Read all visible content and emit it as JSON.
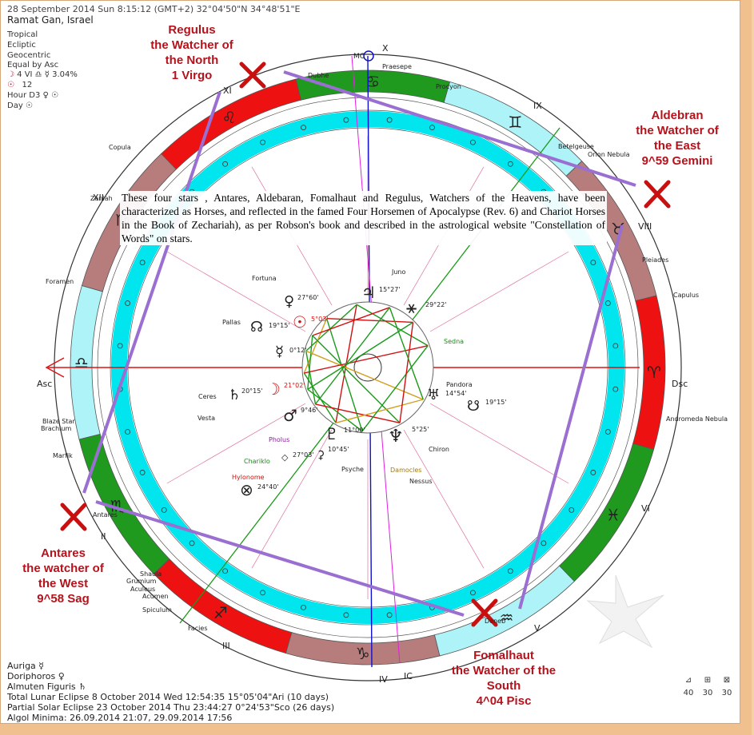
{
  "header": {
    "datetime": "28 September 2014   Sun    8:15:12 (GMT+2) 32°04'50\"N  34°48'51\"E",
    "place": "Ramat Gan, Israel",
    "settings": [
      "Tropical",
      "Ecliptic",
      "Geocentric",
      "Equal by Asc"
    ],
    "moon_phase": "4 VI ♎ ☿ 3.04%",
    "sun_line": "12",
    "hour": "Hour D3 ♀ ☉",
    "day": "Day ☉"
  },
  "annotations": {
    "regulus": [
      "Regulus",
      "the Watcher of",
      "the North",
      "1 Virgo"
    ],
    "aldebran": [
      "Aldebran",
      "the Watcher of",
      "the East",
      "9^59 Gemini"
    ],
    "antares": [
      "Antares",
      "the watcher of",
      "the     West",
      "9^58 Sag"
    ],
    "fomalhaut": [
      "Fomalhaut",
      "the Watcher of the",
      "South",
      "4^04 Pisc"
    ]
  },
  "quote": "These four stars , Antares, Aldebaran, Fomalhaut and Regulus, Watchers of the Heavens, have been characterized as Horses, and reflected in the famed Four Horsemen of Apocalypse (Rev. 6) and Chariot Horses in the Book of Zechariah), as per Robson's book and described in the astrological website \"Constellation of Words\" on stars.",
  "chart": {
    "angles": {
      "asc": "Asc",
      "dsc": "Dsc",
      "mc": "MC",
      "ic": "IC"
    },
    "houses": [
      "II",
      "III",
      "IV",
      "V",
      "VI",
      "VIII",
      "IX",
      "X",
      "XI",
      "XII"
    ],
    "stars": [
      "Praesepe",
      "Dubhe",
      "Procyon",
      "Betelgeuse",
      "Orion Nebula",
      "Pleiades",
      "Capulus",
      "Andromeda Nebula",
      "Copula",
      "Zaniah",
      "Foramen",
      "Blaze Star",
      "Brachium",
      "Marfik",
      "Antares",
      "Shaula",
      "Grumium",
      "Aculeus",
      "Acumen",
      "Spiculum",
      "Facies",
      "Deneb",
      "Juno",
      "Fortuna",
      "Pallas",
      "Ceres",
      "Vesta",
      "Pholus",
      "Chariklo",
      "Hylonome",
      "Psyche",
      "Damocles",
      "Nessus",
      "Chiron",
      "Pandora",
      "Sedna"
    ],
    "planet_positions": {
      "jupiter": "15°27'",
      "saturn": "20°15'",
      "moon": "21°02'",
      "venus": "27°60'",
      "sun": "5°03'",
      "node": "19°15'",
      "mercury": "0°12'",
      "mars": "9°46'",
      "pluto": "11°00'",
      "neptune": "5°25'",
      "uranus": "14°54'",
      "south_node": "19°15'",
      "lilith": "27°03'",
      "ceres_alt": "10°45'",
      "fortuna_alt": "24°40'",
      "arrow_pt": "29°22'"
    },
    "colors": {
      "aqua": "#00e5ee",
      "red": "#ee1111",
      "green": "#1f9a1f",
      "rose": "#b77c7c",
      "lightcyan": "#aef3f7",
      "purple": "#9a6fd1"
    }
  },
  "footer": {
    "lines": [
      "Auriga  ☿",
      "Doriphoros  ♀",
      "Almuten Figuris  ♄",
      "Total Lunar Eclipse 8 October 2014 Wed 12:54:35 15°05'04\"Ari (10 days)",
      "Partial Solar Eclipse 23 October 2014 Thu 23:44:27  0°24'53\"Sco (26 days)",
      "Algol Minima: 26.09.2014 21:07,  29.09.2014 17:56"
    ],
    "zoom_values": [
      "40",
      "30",
      "30"
    ]
  }
}
